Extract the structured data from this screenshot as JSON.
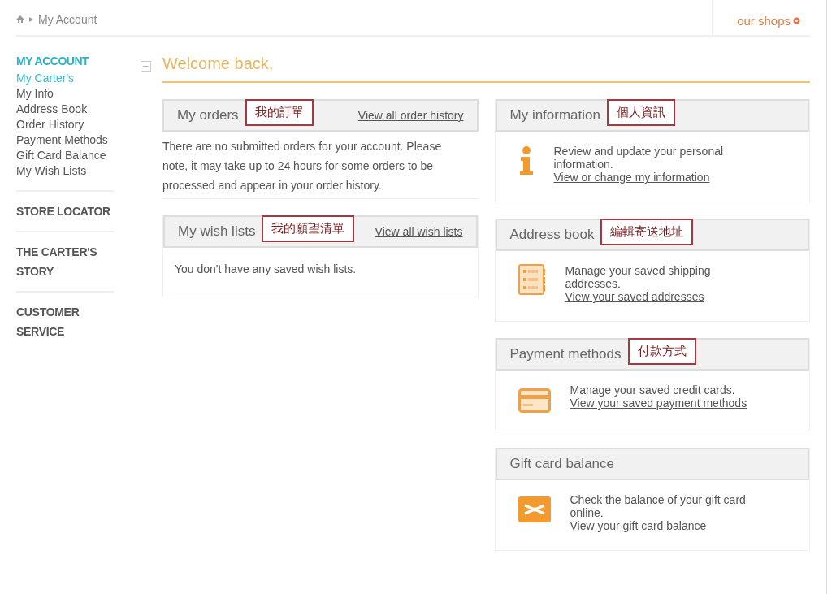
{
  "breadcrumb": {
    "current": "My Account"
  },
  "header_link": "our shops",
  "sidebar": {
    "title": "MY ACCOUNT",
    "items": [
      {
        "label": "My Carter's",
        "selected": true
      },
      {
        "label": "My Info",
        "selected": false
      },
      {
        "label": "Address Book",
        "selected": false
      },
      {
        "label": "Order History",
        "selected": false
      },
      {
        "label": "Payment Methods",
        "selected": false
      },
      {
        "label": "Gift Card Balance",
        "selected": false
      },
      {
        "label": "My Wish Lists",
        "selected": false
      }
    ],
    "sections": [
      "STORE LOCATOR",
      "THE CARTER'S STORY",
      "CUSTOMER SERVICE"
    ]
  },
  "welcome": "Welcome back,",
  "left_cards": [
    {
      "title": "My orders",
      "callout": "我的訂單",
      "link": "View all order history",
      "body": "There are no submitted orders for your account. Please note, it may take up to 24 hours for some orders to be processed and appear in your order history.",
      "kind": "plain"
    },
    {
      "title": "My wish lists",
      "callout": "我的願望清單",
      "link": "View all wish lists",
      "body": "You don't have any saved wish lists.",
      "kind": "boxed"
    }
  ],
  "right_cards": [
    {
      "kind": "info",
      "title": "My information",
      "callout": "個人資訊",
      "description": "Review and update your personal information.",
      "link": "View or change my information"
    },
    {
      "kind": "address",
      "title": "Address book",
      "callout": "編輯寄送地址",
      "description": "Manage your saved shipping addresses.",
      "link": "View your saved addresses"
    },
    {
      "kind": "card",
      "title": "Payment methods",
      "callout": "付款方式",
      "description": "Manage your saved credit cards.",
      "link": "View your saved payment methods"
    },
    {
      "kind": "gift",
      "title": "Gift card balance",
      "description": "Check the balance of your gift card online.",
      "link": "View your gift card balance"
    }
  ]
}
